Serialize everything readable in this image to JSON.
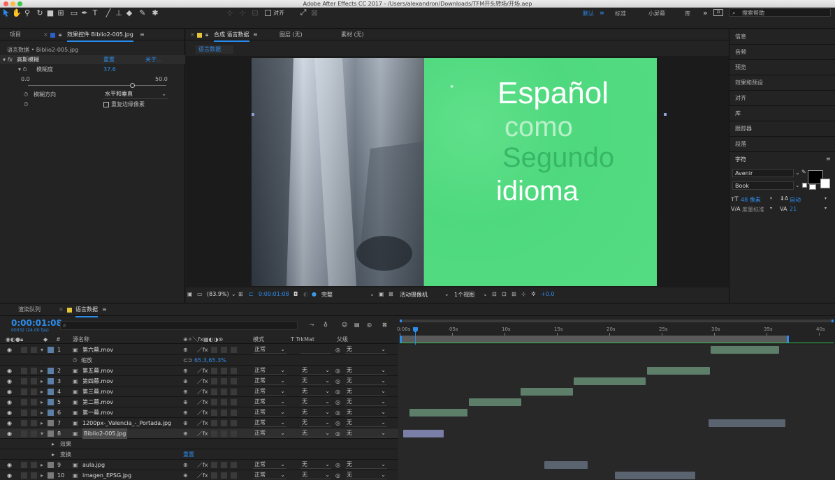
{
  "window": {
    "title": "Adobe After Effects CC 2017 - /Users/alexandron/Downloads/TFM开头转场/开场.aep"
  },
  "toolbar": {
    "align_label": "对齐",
    "workspaces": [
      "默认",
      "标准",
      "小屏幕",
      "库"
    ],
    "search_placeholder": "搜索帮助"
  },
  "effects_panel": {
    "tab_project": "项目",
    "tab_effects": "效果控件 Biblio2-005.jpg",
    "layer_path": "语言数据 • Biblio2-005.jpg",
    "effect_name": "高斯模糊",
    "reset": "重置",
    "about": "关于...",
    "blur_label": "模糊度",
    "blur_value": "37.6",
    "slider_min": "0.0",
    "slider_max": "50.0",
    "blur_fraction": 0.752,
    "direction_label": "模糊方向",
    "direction_value": "水平和垂直",
    "repeat_label": "重复边缘像素"
  },
  "comp_panel": {
    "tab_comp": "合成 语言数据",
    "tab_layer": "图层 (无)",
    "tab_footage": "素材 (无)",
    "comp_chip": "语言数据",
    "lines": [
      "Español",
      "como",
      "Segundo",
      "idioma"
    ],
    "zoom": "(83.9%)",
    "timecode": "0:00:01:08",
    "quality": "完整",
    "camera": "活动摄像机",
    "views": "1个视图",
    "exposure": "+0.0"
  },
  "right_panels": {
    "items": [
      "信息",
      "音频",
      "预览",
      "效果和预设",
      "对齐",
      "库",
      "跟踪器",
      "段落",
      "字符"
    ],
    "font": "Avenir",
    "style": "Book",
    "font_size": "48 像素",
    "leading": "自动",
    "kerning": "度量标准",
    "tracking": "21"
  },
  "timeline": {
    "tab_render": "渲染队列",
    "tab_comp": "语言数据",
    "timecode": "0:00:01:08",
    "frames": "00032 (24.00 fps)",
    "col_source": "源名称",
    "col_mode": "模式",
    "col_trkmat": "T TrkMat",
    "col_parent": "父级",
    "ruler": [
      "0:00s",
      "05s",
      "10s",
      "15s",
      "20s",
      "25s",
      "30s",
      "35s",
      "40s"
    ],
    "layers": [
      {
        "num": "1",
        "name": "第六幕.mov",
        "mode": "正常",
        "trk": "",
        "parent": "无"
      },
      {
        "num": "2",
        "name": "第五幕.mov",
        "mode": "正常",
        "trk": "无",
        "parent": "无"
      },
      {
        "num": "3",
        "name": "第四幕.mov",
        "mode": "正常",
        "trk": "无",
        "parent": "无"
      },
      {
        "num": "4",
        "name": "第三幕.mov",
        "mode": "正常",
        "trk": "无",
        "parent": "无"
      },
      {
        "num": "5",
        "name": "第二幕.mov",
        "mode": "正常",
        "trk": "无",
        "parent": "无"
      },
      {
        "num": "6",
        "name": "第一幕.mov",
        "mode": "正常",
        "trk": "无",
        "parent": "无"
      },
      {
        "num": "7",
        "name": "1200px-_Valencia_-_Portada.jpg",
        "mode": "正常",
        "trk": "无",
        "parent": "无"
      },
      {
        "num": "8",
        "name": "Biblio2-005.jpg",
        "mode": "正常",
        "trk": "无",
        "parent": "无"
      },
      {
        "num": "9",
        "name": "aula.jpg",
        "mode": "正常",
        "trk": "无",
        "parent": "无"
      },
      {
        "num": "10",
        "name": "imagen_EPSG.jpg",
        "mode": "正常",
        "trk": "无",
        "parent": "无"
      }
    ],
    "scale_label": "缩放",
    "scale_value": "65.3,65.3%",
    "effects_label": "效果",
    "transform_label": "变换",
    "transform_reset": "重置"
  }
}
